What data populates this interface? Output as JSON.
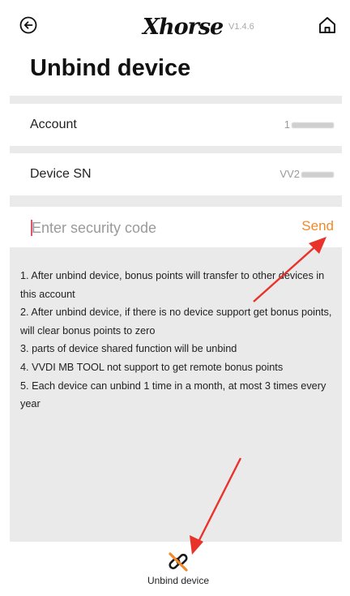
{
  "header": {
    "brand_name": "Xhorse",
    "version": "V1.4.6",
    "back_icon": "back-circle-icon",
    "home_icon": "home-icon"
  },
  "page": {
    "title": "Unbind device"
  },
  "fields": [
    {
      "label": "Account",
      "value_visible": "1"
    },
    {
      "label": "Device SN",
      "value_visible": "VV2"
    }
  ],
  "security_code": {
    "placeholder": "Enter security code",
    "value": "",
    "send_label": "Send"
  },
  "notes": [
    "1. After unbind device, bonus points will transfer to other devices in this account",
    "2. After unbind device, if there is no device support get bonus points, will clear bonus points to zero",
    "3. parts of device shared function will be unbind",
    "4. VVDI MB TOOL not support to get remote bonus points",
    "5. Each device can unbind 1 time in a month, at most 3 times every year"
  ],
  "bottom_action": {
    "label": "Unbind device",
    "icon": "unlink-icon"
  },
  "colors": {
    "accent": "#f08a2a",
    "panel_bg": "#eaeaea",
    "caret": "#e0556a",
    "annotation_arrow": "#e8322a"
  }
}
